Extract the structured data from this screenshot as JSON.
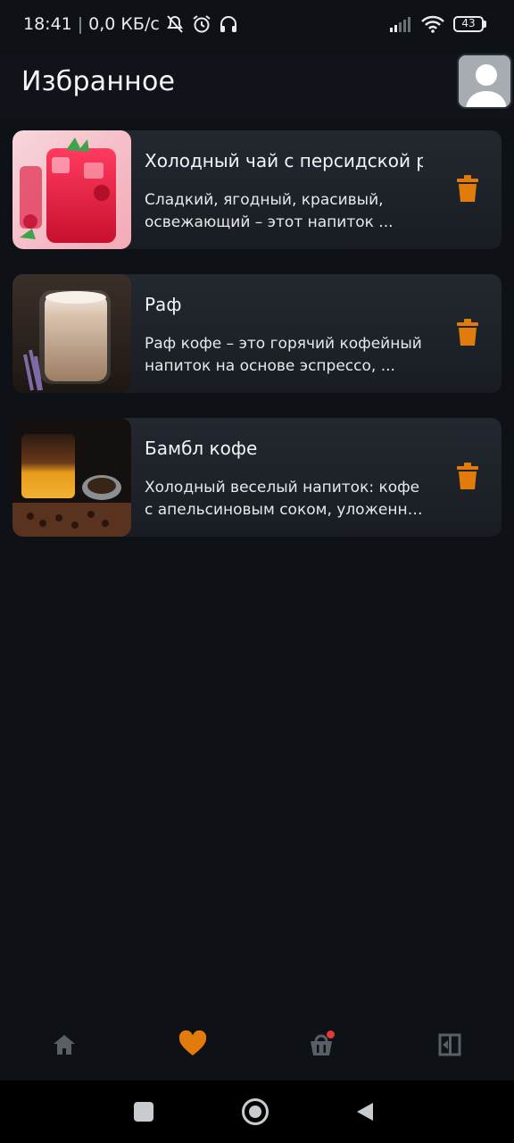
{
  "status_bar": {
    "time": "18:41",
    "network_speed": "0,0 КБ/с",
    "battery_level": "43",
    "icons": [
      "mute-icon",
      "alarm-icon",
      "headphones-icon",
      "signal-icon",
      "wifi-icon",
      "battery-icon"
    ]
  },
  "header": {
    "title": "Избранное",
    "avatar_icon": "user-avatar-icon"
  },
  "favorites": [
    {
      "title": "Холодный чай с персидской розой",
      "description": "Сладкий, ягодный, красивый, освежающий – этот напиток ...",
      "image": "iced-berry-tea-photo",
      "delete_icon": "trash-icon"
    },
    {
      "title": "Раф",
      "description": "Раф кофе – это горячий кофейный напиток на основе эспрессо, ...",
      "image": "raf-coffee-photo",
      "delete_icon": "trash-icon"
    },
    {
      "title": "Бамбл кофе",
      "description": "Холодный веселый напиток: кофе с апельсиновым соком, уложенн…",
      "image": "bumble-coffee-photo",
      "delete_icon": "trash-icon"
    }
  ],
  "bottom_nav": {
    "items": [
      {
        "icon": "home-icon",
        "active": false
      },
      {
        "icon": "heart-icon",
        "active": true
      },
      {
        "icon": "basket-icon",
        "active": false,
        "badge": true
      },
      {
        "icon": "logout-icon",
        "active": false
      }
    ],
    "active_color": "#e07b0c",
    "inactive_color": "#5a5f66"
  },
  "colors": {
    "accent": "#e07b0c",
    "background": "#0e1116",
    "card": "#1e2229"
  }
}
